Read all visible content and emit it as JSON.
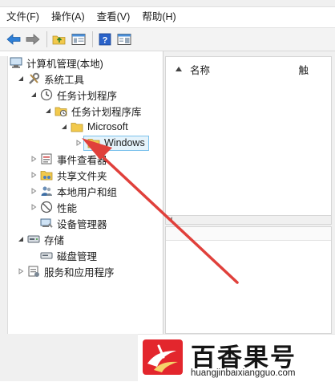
{
  "menu": {
    "items": [
      "文件(F)",
      "操作(A)",
      "查看(V)",
      "帮助(H)"
    ]
  },
  "tree": {
    "root": "计算机管理(本地)",
    "system_tools": "系统工具",
    "task_scheduler": "任务计划程序",
    "task_library": "任务计划程序库",
    "microsoft": "Microsoft",
    "windows": "Windows",
    "event_viewer": "事件查看器",
    "shared_folders": "共享文件夹",
    "local_users": "本地用户和组",
    "performance": "性能",
    "device_manager": "设备管理器",
    "storage": "存储",
    "disk_management": "磁盘管理",
    "services_apps": "服务和应用程序"
  },
  "list": {
    "col_name": "名称",
    "col_status": "触"
  },
  "watermark": {
    "title": "百香果号",
    "url": "huangjinbaixiangguo.com"
  },
  "colors": {
    "arrow": "#e0403b",
    "selection_border": "#7dc2ec",
    "brand_red": "#e3262d"
  }
}
